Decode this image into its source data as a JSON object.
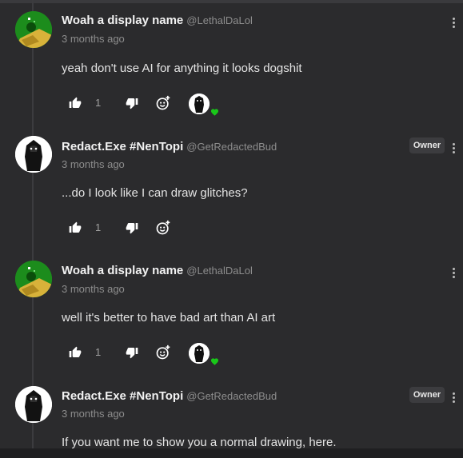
{
  "colors": {
    "background": "#2b2b2d",
    "heart": "#19c819",
    "owner_badge_bg": "#3c3c3f"
  },
  "comments": [
    {
      "author": "Woah a display name",
      "handle": "@LethalDaLol",
      "time": "3 months ago",
      "text": "yeah don't use AI for anything it looks dogshit",
      "likes": "1",
      "owner_badge": "",
      "hearted": true
    },
    {
      "author": "Redact.Exe #NenTopi",
      "handle": "@GetRedactedBud",
      "time": "3 months ago",
      "text": "...do I look like I can draw glitches?",
      "likes": "1",
      "owner_badge": "Owner",
      "hearted": false
    },
    {
      "author": "Woah a display name",
      "handle": "@LethalDaLol",
      "time": "3 months ago",
      "text": "well it's better to have bad art than AI art",
      "likes": "1",
      "owner_badge": "",
      "hearted": true
    },
    {
      "author": "Redact.Exe #NenTopi",
      "handle": "@GetRedactedBud",
      "time": "3 months ago",
      "text": "If you want me to show you a normal drawing, here.",
      "likes": "",
      "owner_badge": "Owner",
      "hearted": false
    }
  ],
  "icons": {
    "like": "thumbs-up-icon",
    "dislike": "thumbs-down-icon",
    "react": "add-emoji-icon",
    "more": "more-vertical-icon",
    "heart": "heart-icon"
  }
}
